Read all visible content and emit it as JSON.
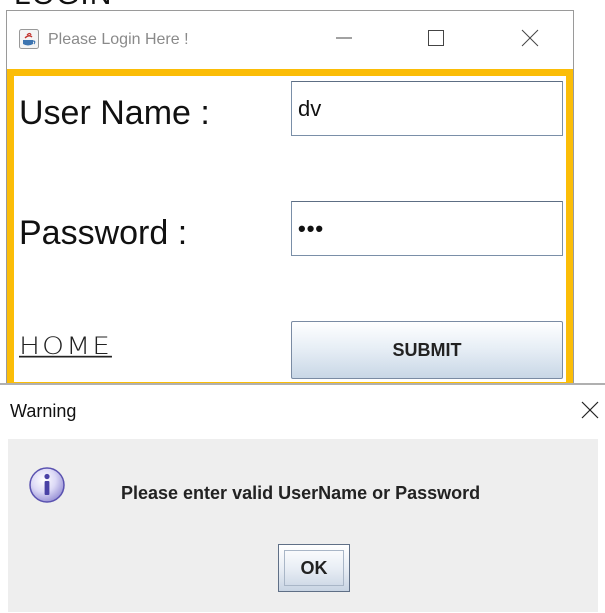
{
  "background_heading": "LOGIN",
  "login_window": {
    "title": "Please Login Here !",
    "icons": {
      "app": "java-cup-icon",
      "minimize": "minimize-icon",
      "maximize": "maximize-icon",
      "close": "close-icon"
    },
    "username_label": "User Name :",
    "username_value": "dv",
    "password_label": "Password :",
    "password_value": "•••",
    "home_link": "HOME",
    "submit_label": "SUBMIT"
  },
  "warning_dialog": {
    "title": "Warning",
    "message": "Please enter valid UserName or Password",
    "ok_label": "OK",
    "icons": {
      "info": "info-icon",
      "close": "close-icon"
    }
  },
  "colors": {
    "panel_border": "#fbbd07",
    "dialog_body": "#eeeeee",
    "title_gray": "#8a8a8a"
  }
}
